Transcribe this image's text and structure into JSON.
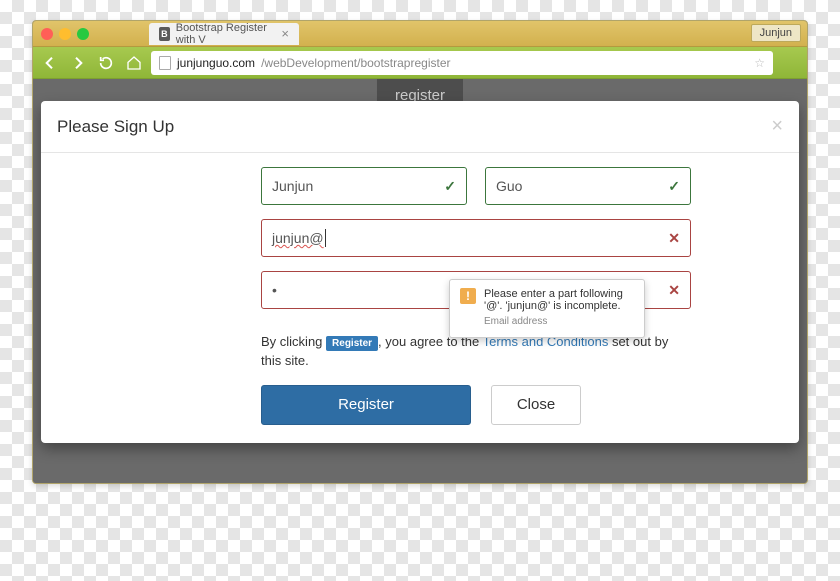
{
  "browser": {
    "tab_title": "Bootstrap Register with V",
    "user_chip": "Junjun",
    "url_host": "junjunguo.com",
    "url_path": "/webDevelopment/bootstrapregister"
  },
  "background_button": "register",
  "modal": {
    "title": "Please Sign Up",
    "close_x": "×",
    "first_name_value": "Junjun",
    "last_name_value": "Guo",
    "email_value": "junjun@",
    "password_value": "•",
    "agree_prefix": "By clicking ",
    "agree_badge": "Register",
    "agree_mid": ", you agree to the ",
    "agree_link": "Terms and Conditions",
    "agree_suffix": " set out by this site.",
    "register_btn": "Register",
    "close_btn": "Close"
  },
  "validation_popover": {
    "message": "Please enter a part following '@'. 'junjun@' is incomplete.",
    "label": "Email address"
  }
}
